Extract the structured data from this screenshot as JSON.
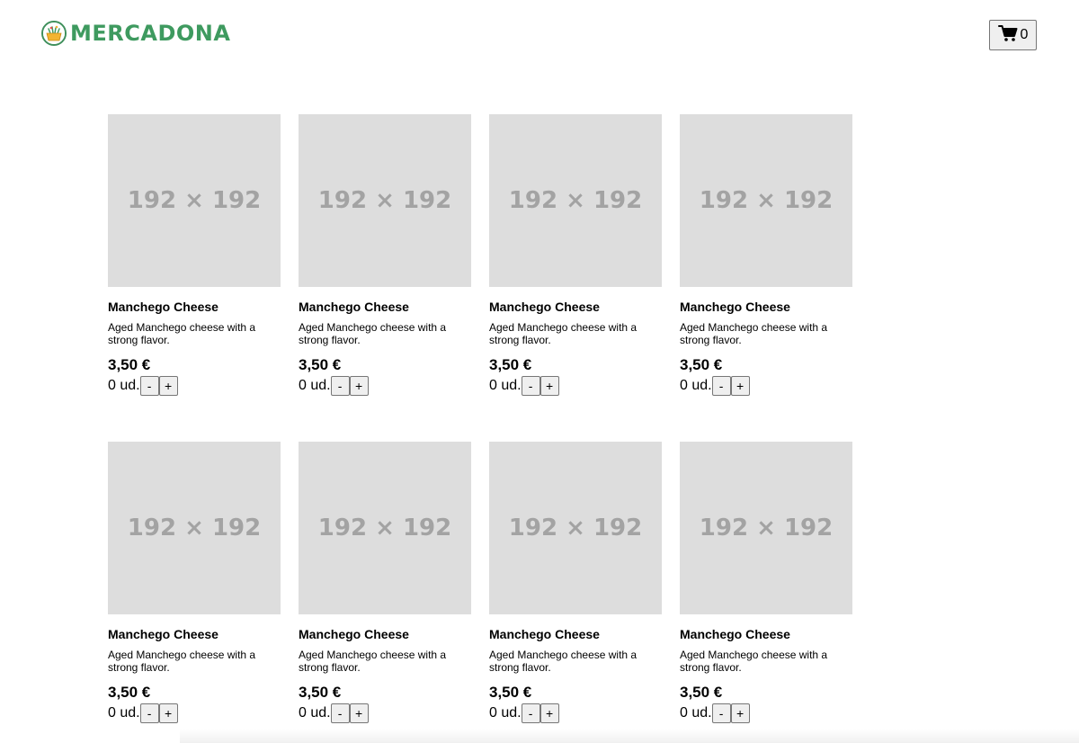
{
  "header": {
    "logo_text": "MERCADONA",
    "brand_color": "#3e9a5f",
    "cart": {
      "icon": "cart-icon",
      "count": "0"
    }
  },
  "products": [
    {
      "image_placeholder": "192 × 192",
      "name": "Manchego Cheese",
      "description": "Aged Manchego cheese with a strong flavor.",
      "price": "3,50 €",
      "qty": "0 ud.",
      "minus": "-",
      "plus": "+"
    },
    {
      "image_placeholder": "192 × 192",
      "name": "Manchego Cheese",
      "description": "Aged Manchego cheese with a strong flavor.",
      "price": "3,50 €",
      "qty": "0 ud.",
      "minus": "-",
      "plus": "+"
    },
    {
      "image_placeholder": "192 × 192",
      "name": "Manchego Cheese",
      "description": "Aged Manchego cheese with a strong flavor.",
      "price": "3,50 €",
      "qty": "0 ud.",
      "minus": "-",
      "plus": "+"
    },
    {
      "image_placeholder": "192 × 192",
      "name": "Manchego Cheese",
      "description": "Aged Manchego cheese with a strong flavor.",
      "price": "3,50 €",
      "qty": "0 ud.",
      "minus": "-",
      "plus": "+"
    },
    {
      "image_placeholder": "192 × 192",
      "name": "Manchego Cheese",
      "description": "Aged Manchego cheese with a strong flavor.",
      "price": "3,50 €",
      "qty": "0 ud.",
      "minus": "-",
      "plus": "+"
    },
    {
      "image_placeholder": "192 × 192",
      "name": "Manchego Cheese",
      "description": "Aged Manchego cheese with a strong flavor.",
      "price": "3,50 €",
      "qty": "0 ud.",
      "minus": "-",
      "plus": "+"
    },
    {
      "image_placeholder": "192 × 192",
      "name": "Manchego Cheese",
      "description": "Aged Manchego cheese with a strong flavor.",
      "price": "3,50 €",
      "qty": "0 ud.",
      "minus": "-",
      "plus": "+"
    },
    {
      "image_placeholder": "192 × 192",
      "name": "Manchego Cheese",
      "description": "Aged Manchego cheese with a strong flavor.",
      "price": "3,50 €",
      "qty": "0 ud.",
      "minus": "-",
      "plus": "+"
    }
  ]
}
